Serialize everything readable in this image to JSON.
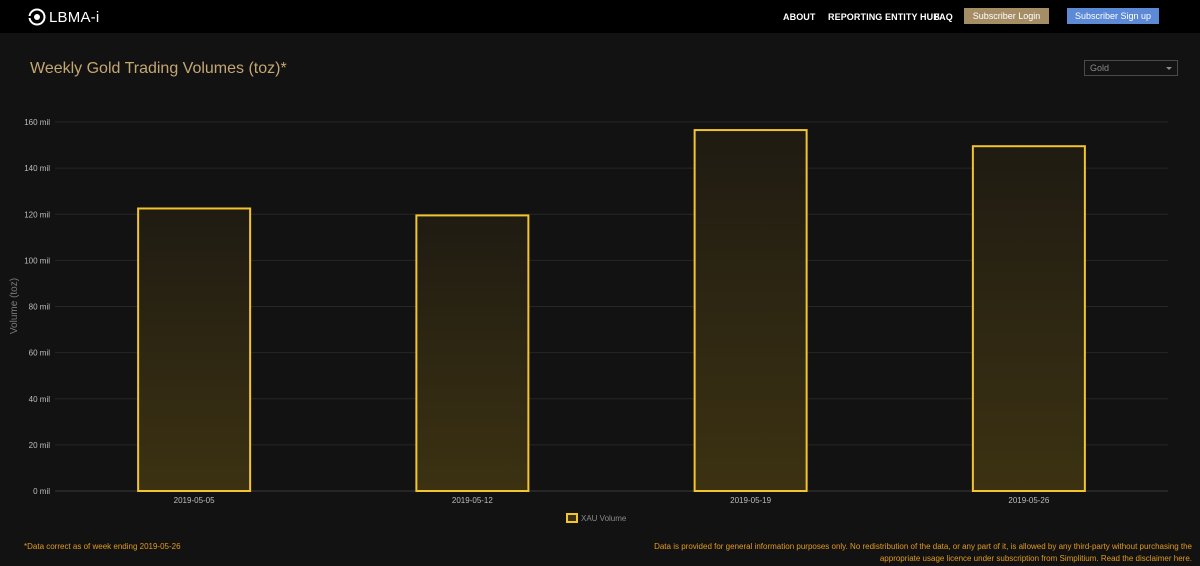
{
  "header": {
    "logo_text": "LBMA-i",
    "nav": [
      "ABOUT",
      "REPORTING ENTITY HUB",
      "FAQ"
    ],
    "login_label": "Subscriber Login",
    "signup_label": "Subscriber Sign up"
  },
  "page": {
    "title": "Weekly Gold Trading Volumes (toz)*",
    "selector_value": "Gold"
  },
  "chart_data": {
    "type": "bar",
    "categories": [
      "2019-05-05",
      "2019-05-12",
      "2019-05-19",
      "2019-05-26"
    ],
    "series": [
      {
        "name": "XAU Volume",
        "values": [
          122.5,
          119.5,
          156.5,
          149.5
        ]
      }
    ],
    "ylabel": "Volume (toz)",
    "ylim": [
      0,
      160
    ],
    "yticks": [
      0,
      20,
      40,
      60,
      80,
      100,
      120,
      140,
      160
    ],
    "ytick_labels": [
      "0 mil",
      "20 mil",
      "40 mil",
      "60 mil",
      "80 mil",
      "100 mil",
      "120 mil",
      "140 mil",
      "160 mil"
    ],
    "grid": true,
    "legend_position": "bottom-center",
    "colors": {
      "bar_stroke": "#f2c42e",
      "bar_fill_top": "#1f1b12",
      "bar_fill_bottom": "#3c3212"
    }
  },
  "footer": {
    "left_note": "*Data correct as of week ending 2019-05-26",
    "disclaimer_line1": "Data is provided for general information purposes only. No redistribution of the data, or any part of it, is allowed by any third-party without purchasing the",
    "disclaimer_line2": "appropriate usage licence under subscription from Simplitium. Read the disclaimer here."
  }
}
